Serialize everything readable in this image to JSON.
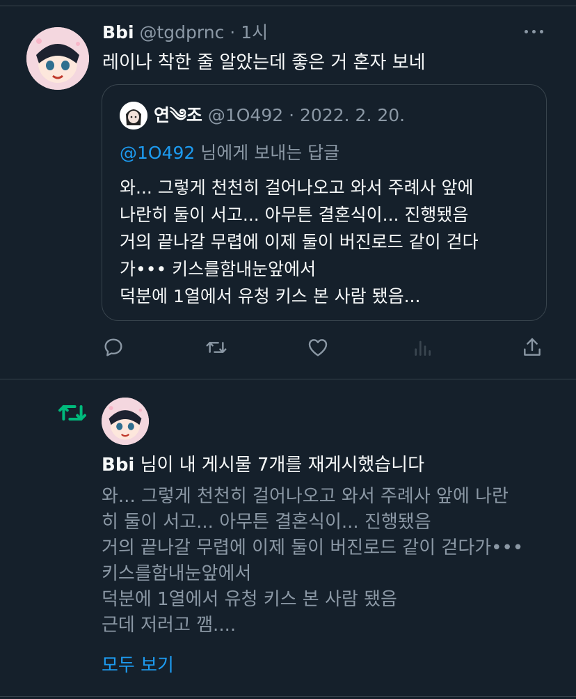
{
  "tweet": {
    "author_name": "Bbi",
    "handle": "@tgdprnc",
    "separator": "·",
    "time": "1시",
    "text": "레이나 착한 줄 알았는데 좋은 거 혼자 보네",
    "quote": {
      "author_name": "연༄조",
      "handle": "@1O492",
      "separator": "·",
      "date": "2022. 2. 20.",
      "reply_to_handle": "@1O492",
      "reply_suffix": " 님에게 보내는 답글",
      "body": "와... 그렇게 천천히 걸어나오고 와서 주례사 앞에\n나란히 둘이 서고... 아무튼 결혼식이... 진행됐음\n거의 끝나갈 무렵에 이제 둘이 버진로드 같이 걷다\n가••• 키스를함내눈앞에서\n덕분에 1열에서 유청 키스 본 사람 됐음..."
    },
    "actions": [
      "reply-icon",
      "retweet-icon",
      "like-icon",
      "analytics-icon",
      "share-icon"
    ]
  },
  "repost_notice": {
    "author_name": "Bbi",
    "notice_text": " 님이 내 게시물 7개를 재게시했습니다",
    "body": "와... 그렇게 천천히 걸어나오고 와서 주례사 앞에 나란\n히 둘이 서고... 아무튼 결혼식이... 진행됐음\n거의 끝나갈 무렵에 이제 둘이 버진로드 같이 걷다가•••\n키스를함내눈앞에서\n덕분에 1열에서 유청 키스 본 사람 됐음\n근데 저러고 깸....",
    "see_all": "모두 보기"
  },
  "colors": {
    "background": "#15202b",
    "text": "#f7f9f9",
    "muted": "#8b98a5",
    "accent": "#1d9bf0",
    "retweet_green": "#00ba7c",
    "border": "#38444d"
  }
}
